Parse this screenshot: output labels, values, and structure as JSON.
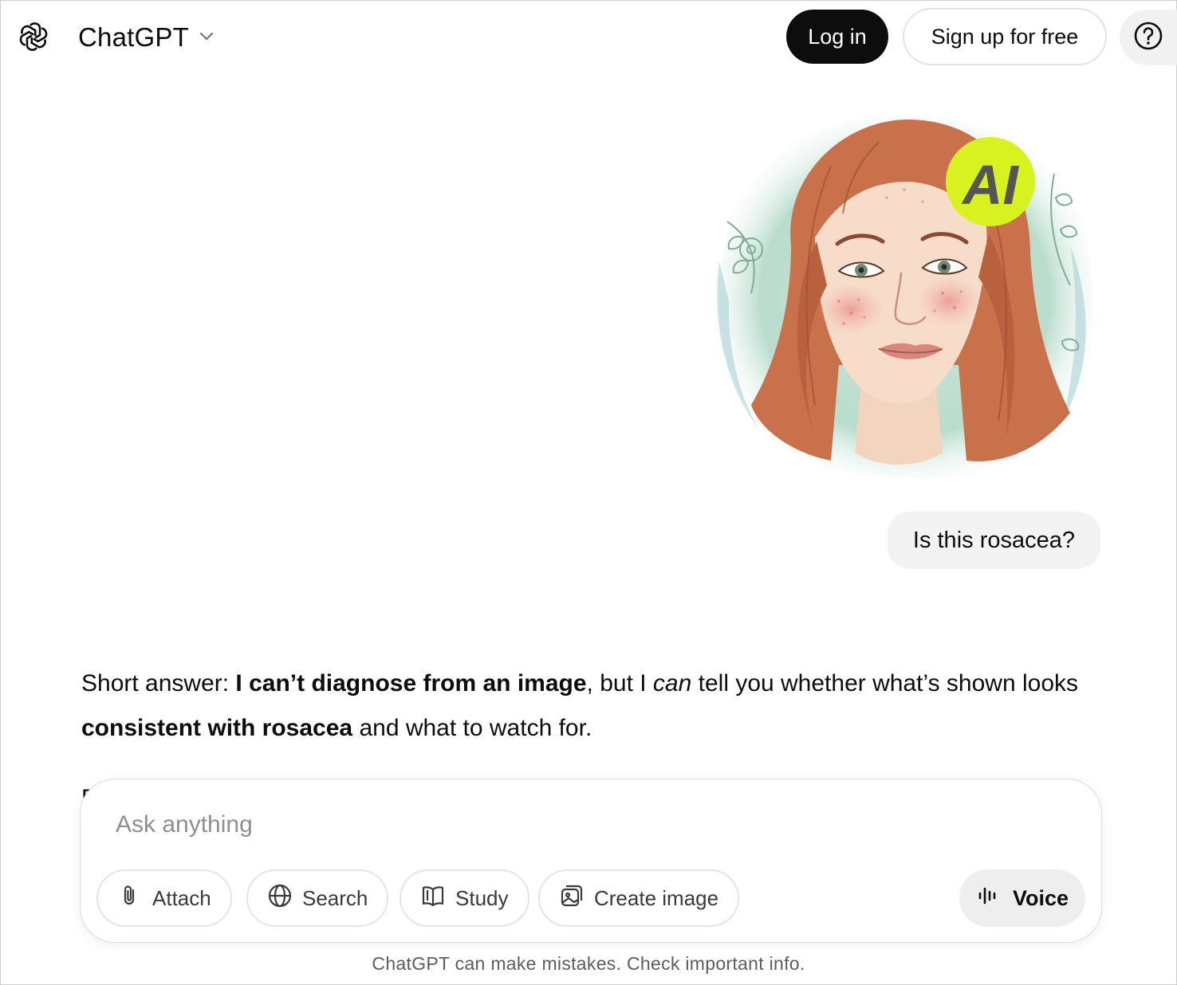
{
  "header": {
    "model_name": "ChatGPT",
    "login_label": "Log in",
    "signup_label": "Sign up for free",
    "help_icon": "question-mark-circle"
  },
  "conversation": {
    "user_image": {
      "badge_text": "AI"
    },
    "user_message": "Is this rosacea?",
    "assistant": {
      "p1_prefix": "Short answer: ",
      "p1_bold1": "I can’t diagnose from an image",
      "p1_mid": ", but I ",
      "p1_italic": "can",
      "p1_rest": " tell you whether what’s shown looks ",
      "p1_bold2": "consistent with rosacea",
      "p1_suffix": " and what to watch for.",
      "clipped_next_char": "F"
    }
  },
  "composer": {
    "placeholder": "Ask anything",
    "tools": [
      {
        "label": "Attach",
        "icon": "paperclip-icon"
      },
      {
        "label": "Search",
        "icon": "globe-icon"
      },
      {
        "label": "Study",
        "icon": "book-icon"
      },
      {
        "label": "Create image",
        "icon": "image-icon"
      }
    ],
    "voice_label": "Voice"
  },
  "footer": {
    "disclaimer": "ChatGPT can make mistakes. Check important info."
  },
  "colors": {
    "primary_button": "#0d0d0d",
    "bubble_bg": "#f3f3f3",
    "ai_badge": "#d8f21f"
  }
}
